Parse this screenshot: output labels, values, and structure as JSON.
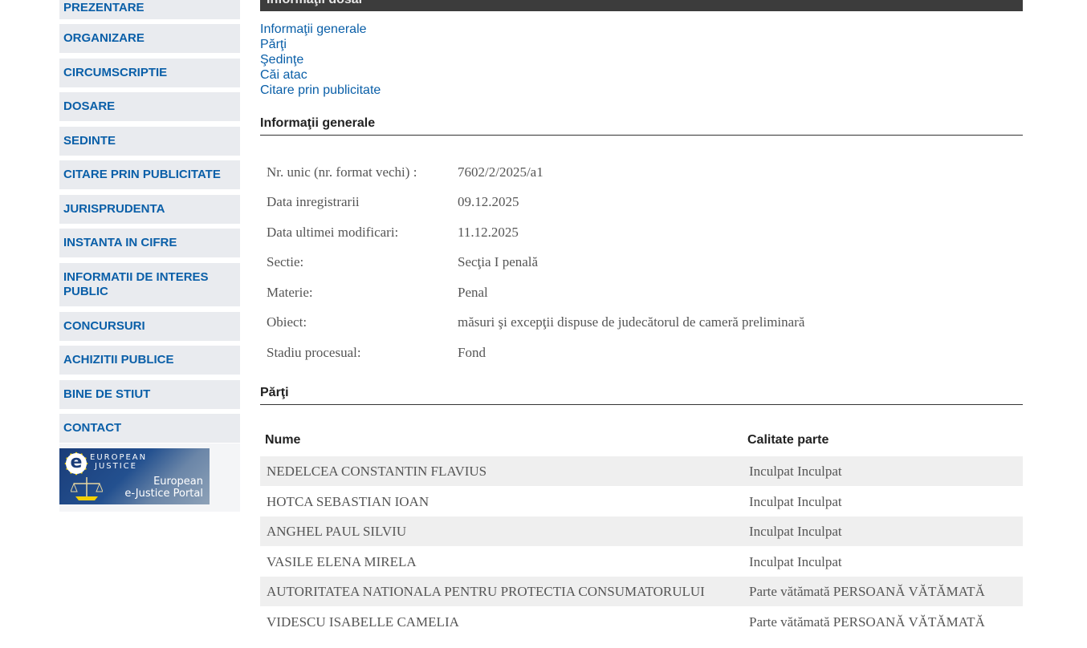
{
  "sidebar": {
    "items": [
      {
        "label": "PREZENTARE"
      },
      {
        "label": "ORGANIZARE"
      },
      {
        "label": "CIRCUMSCRIPTIE"
      },
      {
        "label": "DOSARE"
      },
      {
        "label": "SEDINTE"
      },
      {
        "label": "CITARE PRIN PUBLICITATE"
      },
      {
        "label": "JURISPRUDENTA"
      },
      {
        "label": "INSTANTA IN CIFRE"
      },
      {
        "label": "INFORMATII DE INTERES PUBLIC"
      },
      {
        "label": "CONCURSURI"
      },
      {
        "label": "ACHIZITII PUBLICE"
      },
      {
        "label": "BINE DE STIUT"
      },
      {
        "label": "CONTACT"
      }
    ],
    "banner": {
      "top_line1": "EUROPEAN",
      "top_line2": "JUSTICE",
      "portal_line1": "European",
      "portal_line2": "e-Justice Portal"
    }
  },
  "main": {
    "top_bar_title": "Informaţii dosar",
    "links": [
      "Informaţii generale",
      "Părţi",
      "Şedinţe",
      "Căi atac",
      "Citare prin publicitate"
    ],
    "general": {
      "title": "Informaţii generale",
      "rows": [
        {
          "label": "Nr. unic (nr. format vechi) :",
          "value": "7602/2/2025/a1"
        },
        {
          "label": "Data inregistrarii",
          "value": "09.12.2025"
        },
        {
          "label": "Data ultimei modificari:",
          "value": "11.12.2025"
        },
        {
          "label": "Sectie:",
          "value": "Secţia I penală"
        },
        {
          "label": "Materie:",
          "value": "Penal"
        },
        {
          "label": "Obiect:",
          "value": "măsuri şi excepţii dispuse de judecătorul de cameră preliminară"
        },
        {
          "label": "Stadiu procesual:",
          "value": "Fond"
        }
      ]
    },
    "parties": {
      "title": "Părţi",
      "columns": [
        "Nume",
        "Calitate parte"
      ],
      "rows": [
        {
          "name": "NEDELCEA CONSTANTIN FLAVIUS",
          "role": "Inculpat Inculpat"
        },
        {
          "name": "HOTCA SEBASTIAN IOAN",
          "role": "Inculpat Inculpat"
        },
        {
          "name": "ANGHEL PAUL SILVIU",
          "role": "Inculpat Inculpat"
        },
        {
          "name": "VASILE ELENA MIRELA",
          "role": "Inculpat Inculpat"
        },
        {
          "name": "AUTORITATEA NATIONALA PENTRU PROTECTIA CONSUMATORULUI",
          "role": "Parte vătămată PERSOANĂ VĂTĂMATĂ"
        },
        {
          "name": "VIDESCU ISABELLE CAMELIA",
          "role": "Parte vătămată PERSOANĂ VĂTĂMATĂ"
        }
      ]
    }
  }
}
